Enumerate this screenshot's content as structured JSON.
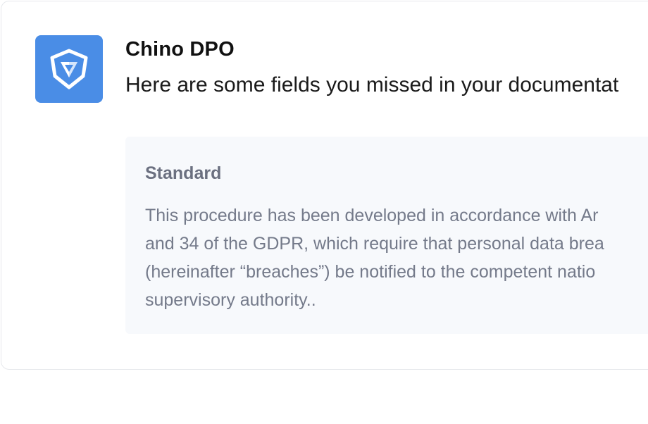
{
  "message": {
    "sender": "Chino DPO",
    "text": "Here are some fields you missed in your documentat",
    "avatar_icon": "shield-logo-icon",
    "avatar_color": "#4a8de6"
  },
  "quote": {
    "title": "Standard",
    "lines": [
      "This procedure has been developed in accordance with Ar",
      "and 34 of the GDPR, which require that personal data brea",
      "(hereinafter “breaches”) be notified to the competent natio",
      "supervisory authority.."
    ]
  }
}
